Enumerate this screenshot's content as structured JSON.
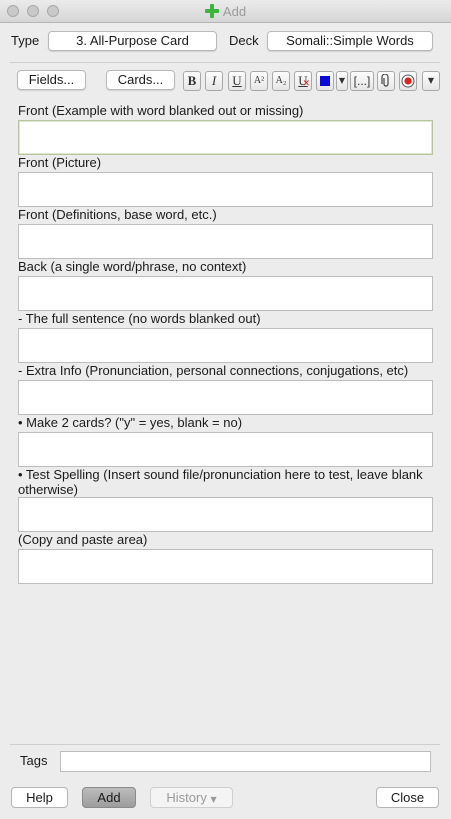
{
  "window": {
    "title": "Add"
  },
  "top": {
    "type_label": "Type",
    "type_value": "3. All-Purpose Card",
    "deck_label": "Deck",
    "deck_value": "Somali::Simple Words"
  },
  "toolbar": {
    "fields_label": "Fields...",
    "cards_label": "Cards...",
    "bold": "B",
    "italic": "I",
    "underline": "U",
    "superscript": "A²",
    "subscript": "A₂",
    "clear_format": "U",
    "cloze": "[...]",
    "text_color": "#0a0adc"
  },
  "fields": [
    {
      "label": "Front (Example with word blanked out or missing)"
    },
    {
      "label": "Front (Picture)"
    },
    {
      "label": "Front (Definitions, base word, etc.)"
    },
    {
      "label": "Back (a single word/phrase, no context)"
    },
    {
      "label": "- The full sentence (no words blanked out)"
    },
    {
      "label": "- Extra Info (Pronunciation, personal connections, conjugations, etc)"
    },
    {
      "label": "• Make 2 cards? (\"y\" = yes, blank = no)"
    },
    {
      "label": "• Test Spelling (Insert sound file/pronunciation here to test, leave blank otherwise)"
    },
    {
      "label": "(Copy and paste area)"
    }
  ],
  "tags": {
    "label": "Tags",
    "value": ""
  },
  "bottom": {
    "help_label": "Help",
    "add_label": "Add",
    "history_label": "History",
    "close_label": "Close"
  }
}
